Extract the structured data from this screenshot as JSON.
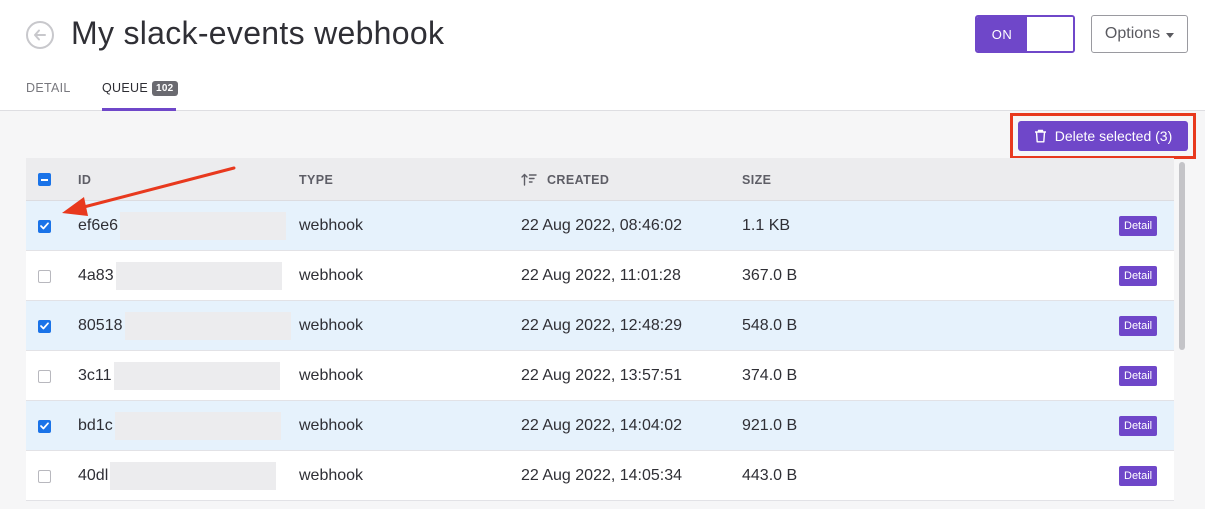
{
  "header": {
    "title": "My slack-events webhook",
    "toggle_label": "ON",
    "options_label": "Options"
  },
  "tabs": [
    {
      "label": "DETAIL"
    },
    {
      "label": "QUEUE",
      "badge": "102"
    }
  ],
  "actions": {
    "delete_selected_label": "Delete selected (3)"
  },
  "table": {
    "columns": {
      "id": "ID",
      "type": "TYPE",
      "created": "CREATED",
      "size": "SIZE"
    },
    "rows": [
      {
        "id": "ef6e6",
        "type": "webhook",
        "created": "22 Aug 2022, 08:46:02",
        "size": "1.1 KB",
        "selected": true,
        "action": "Detail"
      },
      {
        "id": "4a83",
        "type": "webhook",
        "created": "22 Aug 2022, 11:01:28",
        "size": "367.0 B",
        "selected": false,
        "action": "Detail"
      },
      {
        "id": "80518",
        "type": "webhook",
        "created": "22 Aug 2022, 12:48:29",
        "size": "548.0 B",
        "selected": true,
        "action": "Detail"
      },
      {
        "id": "3c11",
        "type": "webhook",
        "created": "22 Aug 2022, 13:57:51",
        "size": "374.0 B",
        "selected": false,
        "action": "Detail"
      },
      {
        "id": "bd1c",
        "type": "webhook",
        "created": "22 Aug 2022, 14:04:02",
        "size": "921.0 B",
        "selected": true,
        "action": "Detail"
      },
      {
        "id": "40dl",
        "type": "webhook",
        "created": "22 Aug 2022, 14:05:34",
        "size": "443.0 B",
        "selected": false,
        "action": "Detail"
      }
    ]
  },
  "colors": {
    "accent": "#6f47c9",
    "checkbox": "#1a73e8",
    "selected_row": "#e6f2fc",
    "highlight": "#e8391e"
  },
  "icons": {
    "back": "back-arrow-circle-icon",
    "trash": "trash-icon",
    "sort": "sort-desc-icon",
    "annotation": "red-arrow-annotation"
  }
}
